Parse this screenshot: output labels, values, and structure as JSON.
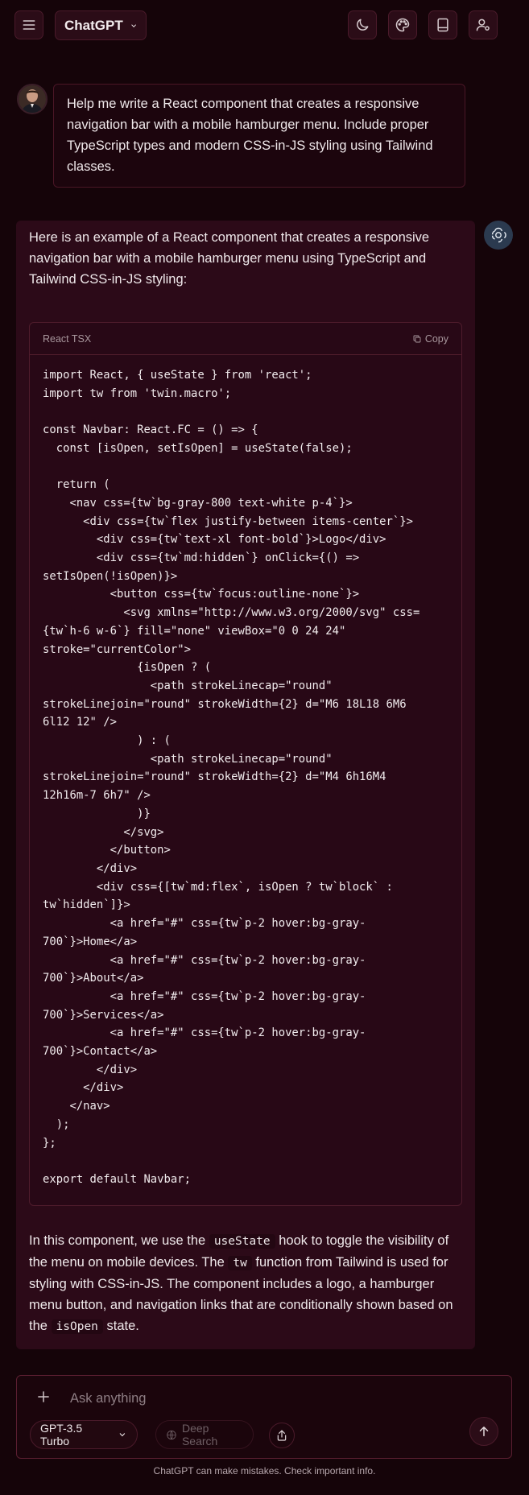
{
  "header": {
    "app_title": "ChatGPT",
    "icons": {
      "menu": "menu-icon",
      "theme": "moon-icon",
      "palette": "palette-icon",
      "library": "book-icon",
      "account": "user-settings-icon"
    }
  },
  "conversation": {
    "user_message": "Help me write a React component that creates a responsive navigation bar with a mobile hamburger menu. Include proper TypeScript types and modern CSS-in-JS styling using Tailwind classes.",
    "assistant": {
      "intro": "Here is an example of a React component that creates a responsive navigation bar with a mobile hamburger menu using TypeScript and Tailwind CSS-in-JS styling:",
      "code_block": {
        "language_label": "React TSX",
        "copy_label": "Copy",
        "code": "import React, { useState } from 'react';\nimport tw from 'twin.macro';\n\nconst Navbar: React.FC = () => {\n  const [isOpen, setIsOpen] = useState(false);\n\n  return (\n    <nav css={tw`bg-gray-800 text-white p-4`}>\n      <div css={tw`flex justify-between items-center`}>\n        <div css={tw`text-xl font-bold`}>Logo</div>\n        <div css={tw`md:hidden`} onClick={() =>\nsetIsOpen(!isOpen)}>\n          <button css={tw`focus:outline-none`}>\n            <svg xmlns=\"http://www.w3.org/2000/svg\" css=\n{tw`h-6 w-6`} fill=\"none\" viewBox=\"0 0 24 24\"\nstroke=\"currentColor\">\n              {isOpen ? (\n                <path strokeLinecap=\"round\"\nstrokeLinejoin=\"round\" strokeWidth={2} d=\"M6 18L18 6M6\n6l12 12\" />\n              ) : (\n                <path strokeLinecap=\"round\"\nstrokeLinejoin=\"round\" strokeWidth={2} d=\"M4 6h16M4\n12h16m-7 6h7\" />\n              )}\n            </svg>\n          </button>\n        </div>\n        <div css={[tw`md:flex`, isOpen ? tw`block` :\ntw`hidden`]}>\n          <a href=\"#\" css={tw`p-2 hover:bg-gray-\n700`}>Home</a>\n          <a href=\"#\" css={tw`p-2 hover:bg-gray-\n700`}>About</a>\n          <a href=\"#\" css={tw`p-2 hover:bg-gray-\n700`}>Services</a>\n          <a href=\"#\" css={tw`p-2 hover:bg-gray-\n700`}>Contact</a>\n        </div>\n      </div>\n    </nav>\n  );\n};\n\nexport default Navbar;"
      },
      "outro": {
        "t1": "In this component, we use the ",
        "c1": "useState",
        "t2": " hook to toggle the visibility of the menu on mobile devices. The ",
        "c2": "tw",
        "t3": " function from Tailwind is used for styling with CSS-in-JS. The component includes a logo, a hamburger menu button, and navigation links that are conditionally shown based on the ",
        "c3": "isOpen",
        "t4": " state."
      }
    }
  },
  "composer": {
    "placeholder": "Ask anything",
    "model_label": "GPT-3.5 Turbo",
    "deep_search_label": "Deep Search",
    "icons": {
      "add": "plus-icon",
      "search": "globe-icon",
      "share": "share-icon",
      "send": "arrow-up-icon"
    }
  },
  "footer": {
    "disclaimer": "ChatGPT can make mistakes. Check important info."
  },
  "colors": {
    "background": "#150409",
    "panel": "#2c0a18",
    "border": "#4a1626",
    "text": "#ece6e8"
  }
}
